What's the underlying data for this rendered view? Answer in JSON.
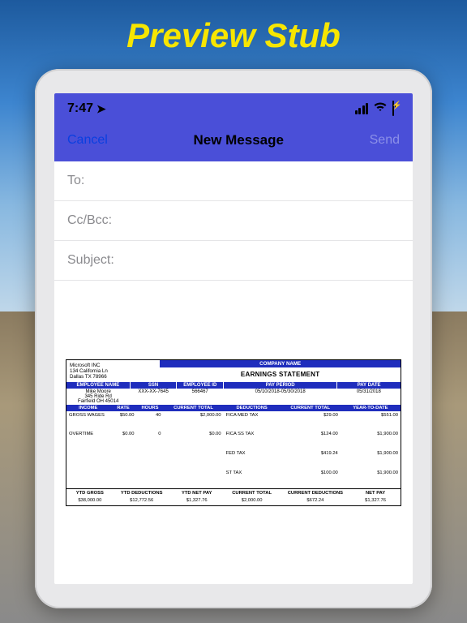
{
  "promo_title": "Preview Stub",
  "status": {
    "time": "7:47",
    "location_on": true
  },
  "nav": {
    "cancel": "Cancel",
    "title": "New Message",
    "send": "Send"
  },
  "fields": {
    "to_label": "To:",
    "cc_label": "Cc/Bcc:",
    "subject_label": "Subject:",
    "to_value": "",
    "cc_value": "",
    "subject_value": ""
  },
  "stub": {
    "company_header": "COMPANY NAME",
    "company_name": "Microsoft INC",
    "company_addr1": "134 California Ln",
    "company_addr2": "Dallas TX 78966",
    "earn_title": "EARNINGS STATEMENT",
    "col_emp_name": "EMPLOYEE NAME",
    "col_ssn": "SSN",
    "col_emp_id": "EMPLOYEE ID",
    "col_pay_period": "PAY PERIOD",
    "col_pay_date": "PAY DATE",
    "emp_name": "Mike Moore",
    "emp_addr1": "345 Ride Rd",
    "emp_addr2": "Fairfield OH 45014",
    "ssn": "XXX-XX-7645",
    "emp_id": "566467",
    "pay_period": "05/10/2018-05/30/2018",
    "pay_date": "05/31/2018",
    "hdr_income": "INCOME",
    "hdr_rate": "RATE",
    "hdr_hours": "HOURS",
    "hdr_curr_total": "CURRENT TOTAL",
    "hdr_deductions": "DEDUCTIONS",
    "hdr_ytd": "YEAR-TO-DATE",
    "income": [
      {
        "label": "GROSS WAGES",
        "rate": "$50.00",
        "hours": "40",
        "total": "$2,000.00"
      },
      {
        "label": "OVERTIME",
        "rate": "$0.00",
        "hours": "0",
        "total": "$0.00"
      }
    ],
    "deductions": [
      {
        "label": "FICA MED TAX",
        "curr": "$29.00",
        "ytd": "$551.00"
      },
      {
        "label": "FICA SS TAX",
        "curr": "$124.00",
        "ytd": "$1,900.00"
      },
      {
        "label": "FED TAX",
        "curr": "$419.24",
        "ytd": "$1,900.00"
      },
      {
        "label": "ST TAX",
        "curr": "$100.00",
        "ytd": "$1,900.00"
      }
    ],
    "lbl_ytd_gross": "YTD GROSS",
    "lbl_ytd_ded": "YTD DEDUCTIONS",
    "lbl_ytd_net": "YTD NET PAY",
    "lbl_curr_tot": "CURRENT TOTAL",
    "lbl_curr_ded": "CURRENT DEDUCTIONS",
    "lbl_net_pay": "NET PAY",
    "val_ytd_gross": "$38,000.00",
    "val_ytd_ded": "$12,772.56",
    "val_ytd_net": "$1,327.76",
    "val_curr_tot": "$2,000.00",
    "val_curr_ded": "$672.24",
    "val_net_pay": "$1,327.76"
  }
}
